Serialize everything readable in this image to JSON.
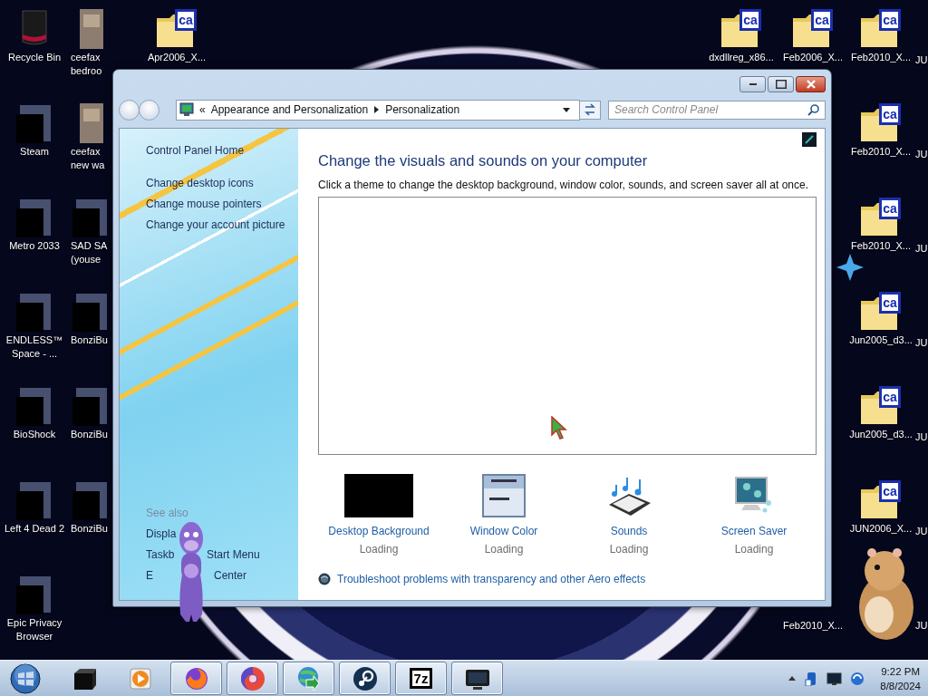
{
  "desktop": {
    "icons": [
      {
        "label": "Recycle Bin",
        "kind": "recycle-bin"
      },
      {
        "label": "Steam",
        "kind": "app"
      },
      {
        "label": "Metro 2033",
        "kind": "app"
      },
      {
        "label": "ENDLESS™ Space - ...",
        "kind": "app"
      },
      {
        "label": "BioShock",
        "kind": "app"
      },
      {
        "label": "Left 4 Dead 2",
        "kind": "app"
      },
      {
        "label": "Epic Privacy Browser",
        "kind": "app"
      },
      {
        "label": "ceefax bedroo",
        "kind": "photo"
      },
      {
        "label": "ceefax new wa",
        "kind": "photo"
      },
      {
        "label": "SAD SA (youse",
        "kind": "app"
      },
      {
        "label": "BonziBu",
        "kind": "app"
      },
      {
        "label": "BonziBu",
        "kind": "app"
      },
      {
        "label": "BonziBu",
        "kind": "app"
      },
      {
        "label": "Apr2006_X...",
        "kind": "folder",
        "badge": "ca"
      },
      {
        "label": "dxdllreg_x86...",
        "kind": "folder",
        "badge": "ca"
      },
      {
        "label": "Feb2006_X...",
        "kind": "folder",
        "badge": "ca"
      },
      {
        "label": "Feb2010_X...",
        "kind": "folder",
        "badge": "ca"
      },
      {
        "label": "Feb2010_X...",
        "kind": "folder",
        "badge": "ca"
      },
      {
        "label": "Feb2010_X...",
        "kind": "folder",
        "badge": "ca"
      },
      {
        "label": "Jun2005_d3...",
        "kind": "folder",
        "badge": "ca"
      },
      {
        "label": "Jun2005_d3...",
        "kind": "folder",
        "badge": "ca"
      },
      {
        "label": "JUN2006_X...",
        "kind": "folder",
        "badge": "ca"
      },
      {
        "label": "Feb2010_X...",
        "kind": "label-only"
      },
      {
        "label": "JU",
        "kind": "label-only"
      },
      {
        "label": "JU",
        "kind": "label-only"
      },
      {
        "label": "JU",
        "kind": "label-only"
      },
      {
        "label": "JU",
        "kind": "label-only"
      },
      {
        "label": "JU",
        "kind": "label-only"
      },
      {
        "label": "JU",
        "kind": "label-only"
      },
      {
        "label": "JU",
        "kind": "label-only"
      }
    ]
  },
  "window": {
    "address": {
      "overflow": "«",
      "crumbs": [
        "Appearance and Personalization",
        "Personalization"
      ]
    },
    "search": {
      "placeholder": "Search Control Panel"
    },
    "sidebar": {
      "links": [
        "Control Panel Home",
        "Change desktop icons",
        "Change mouse pointers",
        "Change your account picture"
      ],
      "see_also_heading": "See also",
      "see_also": [
        {
          "parts": [
            "Displa"
          ]
        },
        {
          "parts": [
            "Taskb",
            "Start Menu"
          ]
        },
        {
          "parts": [
            "E",
            "Center"
          ]
        }
      ]
    },
    "main": {
      "heading": "Change the visuals and sounds on your computer",
      "description": "Click a theme to change the desktop background, window color, sounds, and screen saver all at once.",
      "settings": [
        {
          "label": "Desktop Background",
          "status": "Loading",
          "kind": "background"
        },
        {
          "label": "Window Color",
          "status": "Loading",
          "kind": "window-color"
        },
        {
          "label": "Sounds",
          "status": "Loading",
          "kind": "sounds"
        },
        {
          "label": "Screen Saver",
          "status": "Loading",
          "kind": "screen-saver"
        }
      ],
      "troubleshoot": "Troubleshoot problems with transparency and other Aero effects"
    }
  },
  "taskbar": {
    "items": [
      {
        "kind": "start",
        "running": false
      },
      {
        "kind": "box",
        "running": false
      },
      {
        "kind": "media",
        "running": false
      },
      {
        "kind": "fox",
        "running": true
      },
      {
        "kind": "swirl",
        "running": true
      },
      {
        "kind": "globe-arrow",
        "running": true
      },
      {
        "kind": "steam",
        "running": true
      },
      {
        "kind": "archive",
        "running": true,
        "label": "7z"
      },
      {
        "kind": "monitor",
        "running": true
      }
    ],
    "tray": {
      "time": "9:22 PM",
      "date": "8/8/2024"
    }
  }
}
